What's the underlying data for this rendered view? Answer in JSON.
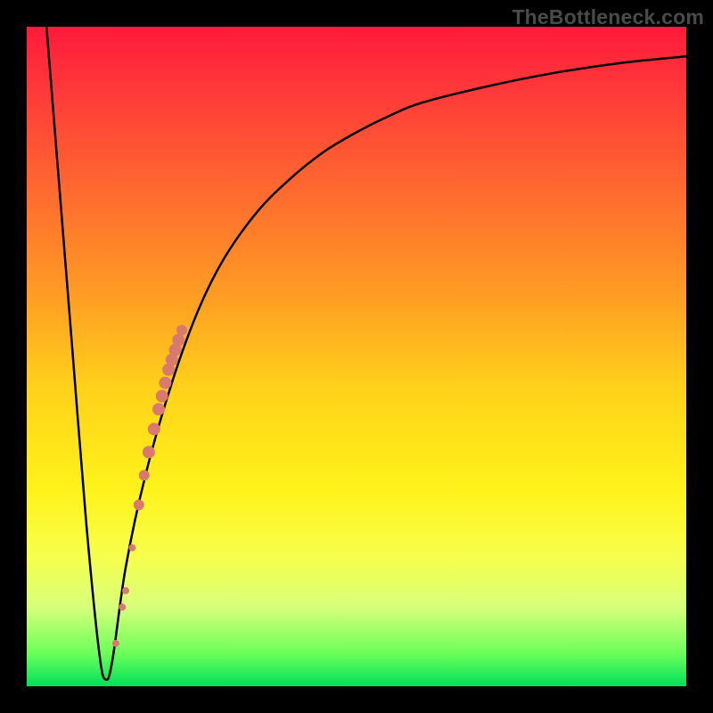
{
  "watermark": "TheBottleneck.com",
  "chart_data": {
    "type": "line",
    "title": "",
    "xlabel": "",
    "ylabel": "",
    "xlim": [
      0,
      100
    ],
    "ylim": [
      0,
      100
    ],
    "grid": false,
    "legend": false,
    "series": [
      {
        "name": "bottleneck-curve",
        "color": "#000000",
        "x": [
          3,
          5,
          7,
          9,
          11,
          12,
          13,
          15,
          18,
          22,
          26,
          30,
          35,
          40,
          45,
          50,
          55,
          60,
          70,
          80,
          90,
          100
        ],
        "y": [
          100,
          75,
          50,
          25,
          5,
          1,
          4,
          18,
          32,
          46,
          57,
          65,
          72,
          77,
          81,
          84,
          86.5,
          88.5,
          91,
          93,
          94.5,
          95.5
        ]
      }
    ],
    "markers": [
      {
        "name": "highlight-dots",
        "color": "#d97a6f",
        "x": [
          13.5,
          14.5,
          15.0,
          16.0,
          17.0,
          17.8,
          18.5,
          19.3,
          20.0,
          20.5,
          21.0,
          21.5,
          22.0,
          22.5,
          23.0,
          23.5
        ],
        "y": [
          6.5,
          12.0,
          14.5,
          21.0,
          27.5,
          32.0,
          35.5,
          39.0,
          42.0,
          44.0,
          46.0,
          48.0,
          49.5,
          51.0,
          52.5,
          54.0
        ],
        "r": [
          4,
          4,
          4,
          4,
          6,
          6,
          7,
          7,
          7,
          7,
          7,
          7,
          7,
          7,
          7,
          6
        ]
      }
    ],
    "background_gradient": {
      "stops": [
        {
          "pos": 0.0,
          "color": "#ff1a3a"
        },
        {
          "pos": 0.1,
          "color": "#ff3a3a"
        },
        {
          "pos": 0.25,
          "color": "#ff6a2f"
        },
        {
          "pos": 0.4,
          "color": "#ff9a24"
        },
        {
          "pos": 0.55,
          "color": "#ffd21a"
        },
        {
          "pos": 0.7,
          "color": "#fff21a"
        },
        {
          "pos": 0.8,
          "color": "#f8ff4a"
        },
        {
          "pos": 0.88,
          "color": "#d8ff7a"
        },
        {
          "pos": 0.95,
          "color": "#6cff5a"
        },
        {
          "pos": 1.0,
          "color": "#00e05a"
        }
      ]
    }
  }
}
